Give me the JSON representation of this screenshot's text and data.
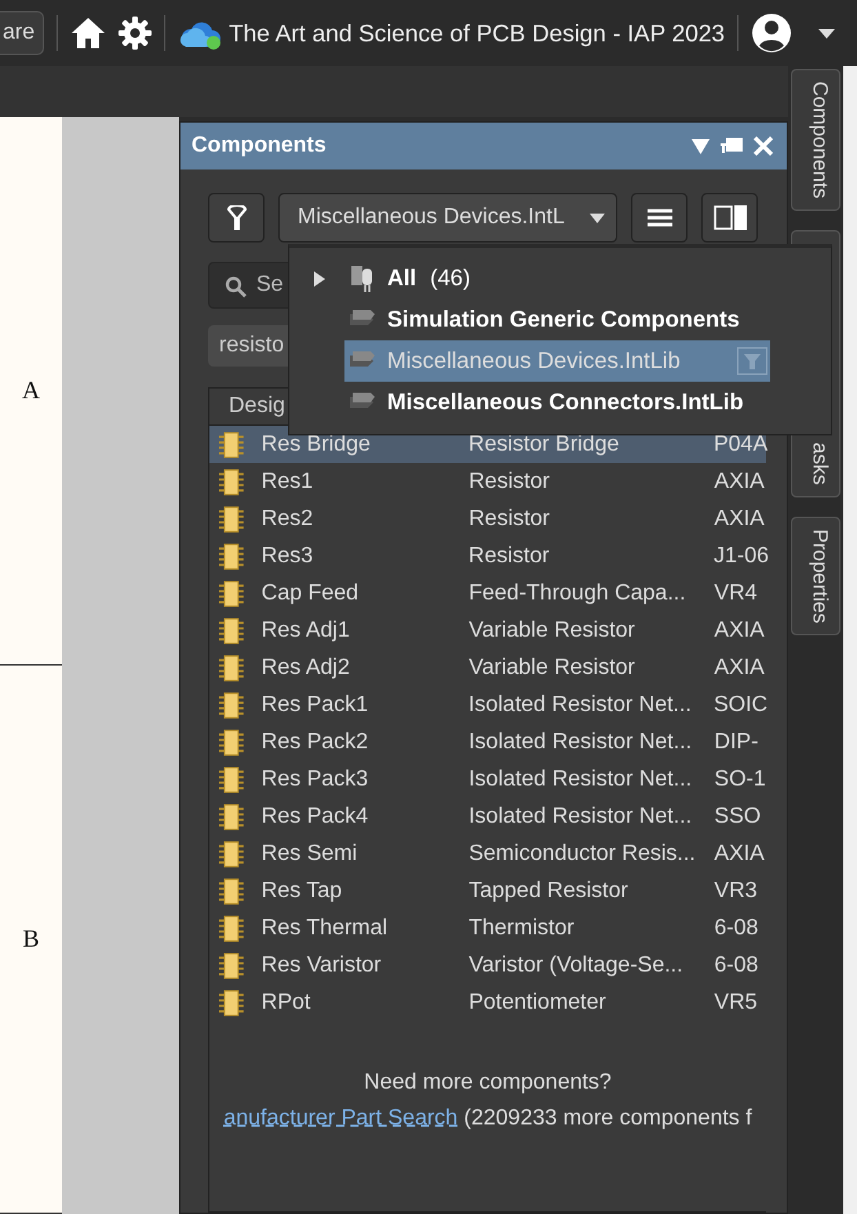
{
  "top_bar": {
    "button": "are",
    "title": "The Art and Science of PCB Design - IAP 2023"
  },
  "schematic": {
    "row_labels": [
      "A",
      "B"
    ]
  },
  "panel": {
    "title": "Components",
    "library_dropdown": "Miscellaneous Devices.IntL",
    "search": {
      "placeholder": "Se"
    },
    "filter_chip": "resisto",
    "dropdown": [
      {
        "kind": "group",
        "label": "All",
        "count": "(46)",
        "selected": false
      },
      {
        "kind": "library",
        "label": "Simulation Generic Components",
        "selected": false
      },
      {
        "kind": "library",
        "label": "Miscellaneous Devices.IntLib",
        "selected": true
      },
      {
        "kind": "library",
        "label": "Miscellaneous Connectors.IntLib",
        "selected": false
      }
    ],
    "table": {
      "columns": [
        "Desig"
      ],
      "rows": [
        {
          "name": "Res Bridge",
          "description": "Resistor Bridge",
          "column_3": "P04A",
          "selected": true
        },
        {
          "name": "Res1",
          "description": "Resistor",
          "column_3": "AXIA",
          "selected": false
        },
        {
          "name": "Res2",
          "description": "Resistor",
          "column_3": "AXIA",
          "selected": false
        },
        {
          "name": "Res3",
          "description": "Resistor",
          "column_3": "J1-06",
          "selected": false
        },
        {
          "name": "Cap Feed",
          "description": "Feed-Through Capa...",
          "column_3": "VR4",
          "selected": false
        },
        {
          "name": "Res Adj1",
          "description": "Variable Resistor",
          "column_3": "AXIA",
          "selected": false
        },
        {
          "name": "Res Adj2",
          "description": "Variable Resistor",
          "column_3": "AXIA",
          "selected": false
        },
        {
          "name": "Res Pack1",
          "description": "Isolated Resistor Net...",
          "column_3": "SOIC",
          "selected": false
        },
        {
          "name": "Res Pack2",
          "description": "Isolated Resistor Net...",
          "column_3": "DIP-",
          "selected": false
        },
        {
          "name": "Res Pack3",
          "description": "Isolated Resistor Net...",
          "column_3": "SO-1",
          "selected": false
        },
        {
          "name": "Res Pack4",
          "description": "Isolated Resistor Net...",
          "column_3": "SSO",
          "selected": false
        },
        {
          "name": "Res Semi",
          "description": "Semiconductor Resis...",
          "column_3": "AXIA",
          "selected": false
        },
        {
          "name": "Res Tap",
          "description": "Tapped Resistor",
          "column_3": "VR3",
          "selected": false
        },
        {
          "name": "Res Thermal",
          "description": "Thermistor",
          "column_3": "6-08",
          "selected": false
        },
        {
          "name": "Res Varistor",
          "description": "Varistor (Voltage-Se...",
          "column_3": "6-08",
          "selected": false
        },
        {
          "name": "RPot",
          "description": "Potentiometer",
          "column_3": "VR5",
          "selected": false
        }
      ]
    },
    "more": {
      "heading": "Need more components?",
      "link": "anufacturer Part Search",
      "text": "(2209233 more components f"
    }
  },
  "side_tabs": [
    "Components",
    "asks",
    "Properties"
  ]
}
